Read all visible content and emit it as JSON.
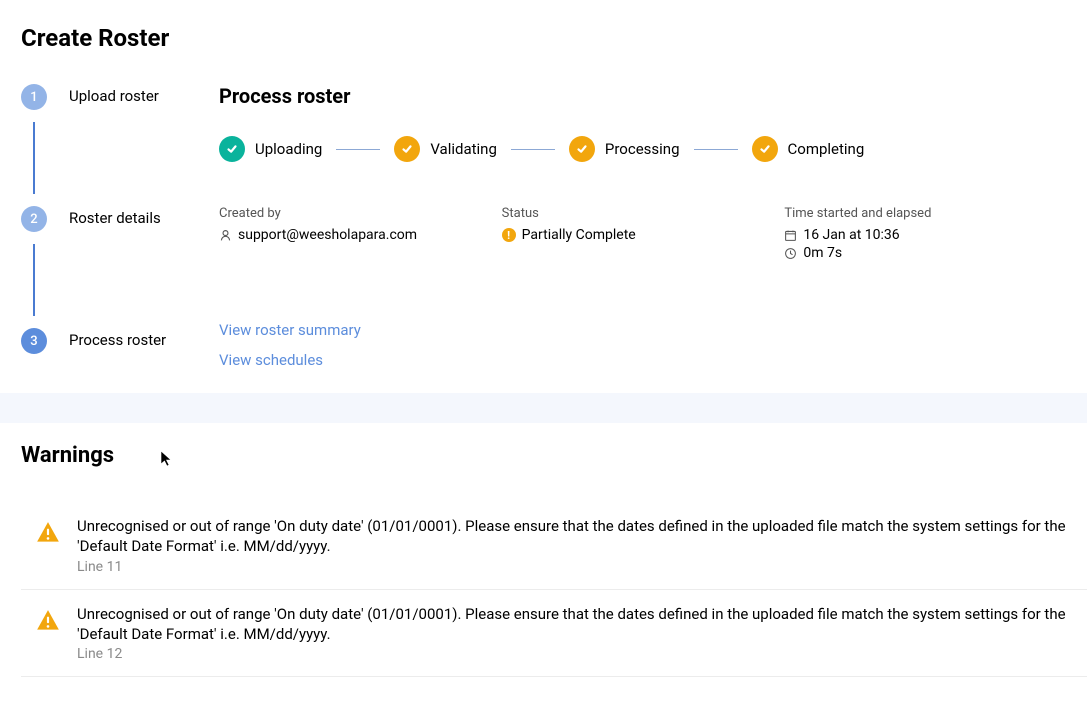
{
  "page_title": "Create Roster",
  "stepper": {
    "steps": [
      {
        "num": "1",
        "label": "Upload roster",
        "tone": "light"
      },
      {
        "num": "2",
        "label": "Roster details",
        "tone": "light"
      },
      {
        "num": "3",
        "label": "Process roster",
        "tone": "solid"
      }
    ]
  },
  "process": {
    "title": "Process roster",
    "stages": [
      {
        "label": "Uploading",
        "color": "green"
      },
      {
        "label": "Validating",
        "color": "orange"
      },
      {
        "label": "Processing",
        "color": "orange"
      },
      {
        "label": "Completing",
        "color": "orange"
      }
    ],
    "info": {
      "created_by_label": "Created by",
      "created_by_value": "support@weesholapara.com",
      "status_label": "Status",
      "status_value": "Partially Complete",
      "time_label": "Time started and elapsed",
      "time_started": "16 Jan at 10:36",
      "time_elapsed": "0m 7s"
    },
    "links": {
      "summary": "View roster summary",
      "schedules": "View schedules"
    }
  },
  "warnings": {
    "title": "Warnings",
    "items": [
      {
        "message": "Unrecognised or out of range 'On duty date' (01/01/0001). Please ensure that the dates defined in the uploaded file match the system settings for the 'Default Date Format' i.e. MM/dd/yyyy.",
        "line": "Line 11"
      },
      {
        "message": "Unrecognised or out of range 'On duty date' (01/01/0001). Please ensure that the dates defined in the uploaded file match the system settings for the 'Default Date Format' i.e. MM/dd/yyyy.",
        "line": "Line 12"
      }
    ]
  }
}
